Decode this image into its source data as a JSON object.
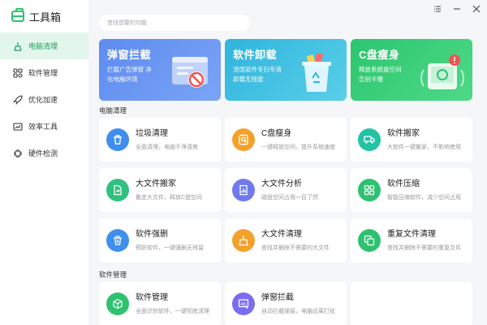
{
  "app": {
    "title": "工具箱"
  },
  "sidebar": {
    "items": [
      {
        "label": "电脑清理",
        "icon": "broom-icon",
        "active": true
      },
      {
        "label": "软件管理",
        "icon": "apps-grid-icon"
      },
      {
        "label": "优化加速",
        "icon": "rocket-icon"
      },
      {
        "label": "效率工具",
        "icon": "chart-icon"
      },
      {
        "label": "硬件检测",
        "icon": "chip-icon"
      }
    ]
  },
  "search": {
    "placeholder": "查找想要的功能"
  },
  "banners": [
    {
      "title": "弹窗拦截",
      "desc": "拦截广告弹窗 净化电脑环境",
      "icon": "popup-block-icon"
    },
    {
      "title": "软件卸载",
      "desc": "流氓软件专扫专清 卸载无残留",
      "icon": "recycle-bin-icon"
    },
    {
      "title": "C盘瘦身",
      "desc": "释放系统盘空间 告别卡慢",
      "icon": "disk-warning-icon"
    }
  ],
  "sections": [
    {
      "title": "电脑清理",
      "cards": [
        {
          "title": "垃圾清理",
          "desc": "全面清理，电脑干净清爽",
          "icon": "trash-icon",
          "color": "#3f8ef0"
        },
        {
          "title": "C盘瘦身",
          "desc": "一键释放空间，提升系统速度",
          "icon": "disk-search-icon",
          "color": "#f4a12b"
        },
        {
          "title": "软件搬家",
          "desc": "大软件一键搬家，不影响使用",
          "icon": "truck-icon",
          "color": "#24c2a5"
        },
        {
          "title": "大文件搬家",
          "desc": "搬走大文件，释放C盘空间",
          "icon": "file-move-icon",
          "color": "#2fc180"
        },
        {
          "title": "大文件分析",
          "desc": "磁盘空间占用一目了然",
          "icon": "file-chart-icon",
          "color": "#6f79f0"
        },
        {
          "title": "软件压缩",
          "desc": "智能压缩软件，减少空间占用",
          "icon": "compress-icon",
          "color": "#2ec270"
        },
        {
          "title": "软件强删",
          "desc": "预防软件，一键强删无残留",
          "icon": "force-delete-icon",
          "color": "#3f8ef0"
        },
        {
          "title": "大文件清理",
          "desc": "查找并删除不需要的大文件",
          "icon": "brush-icon",
          "color": "#f4a12b"
        },
        {
          "title": "重复文件清理",
          "desc": "查找并删除不需要的重复文件",
          "icon": "duplicate-icon",
          "color": "#2ec270"
        }
      ]
    },
    {
      "title": "软件管理",
      "cards": [
        {
          "title": "软件管理",
          "desc": "全面识别软件，一键彻底清理",
          "icon": "box-icon",
          "color": "#2ec270"
        },
        {
          "title": "弹窗拦截",
          "desc": "自动拦截弹窗，电脑远离打扰",
          "icon": "ad-block-icon",
          "color": "#7a6cf0"
        }
      ]
    }
  ],
  "colors": {
    "accent": "#2ec270",
    "active_bg": "#e3f6ec",
    "page_bg": "#f4f6f8"
  }
}
